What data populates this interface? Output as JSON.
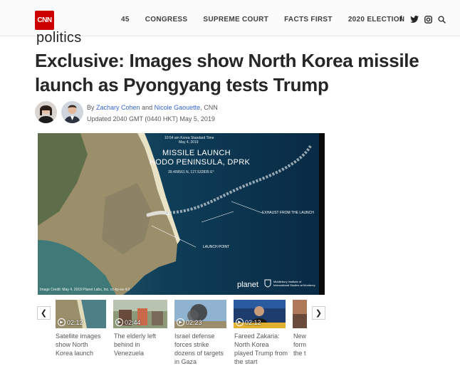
{
  "header": {
    "logo_text": "CNN",
    "nav": [
      "45",
      "CONGRESS",
      "SUPREME COURT",
      "FACTS FIRST",
      "2020 ELECTION"
    ],
    "social_icons": [
      "facebook-icon",
      "twitter-icon",
      "instagram-icon",
      "search-icon"
    ]
  },
  "section": "politics",
  "article": {
    "headline": "Exclusive: Images show North Korea missile launch as Pyongyang tests Trump",
    "by": "By",
    "author1": "Zachary Cohen",
    "and": "and",
    "author2": "Nicole Gaouette",
    "outlet": ", CNN",
    "updated": "Updated 2040 GMT (0440 HKT) May 5, 2019"
  },
  "hero": {
    "time": "10:54 am Korea Standard Time",
    "date": "May 4, 2019",
    "title1": "MISSILE LAUNCH",
    "title2": "HODO PENINSULA, DPRK",
    "coords": "39.409561 N, 127.532835 E°",
    "exhaust_label": "EXHAUST FROM THE LAUNCH",
    "launch_label": "LAUNCH POINT",
    "credit": "Image Credit: May 4, 2019 Planet Labs, Inc. cc-by-sa 4.0",
    "planet": "planet",
    "middlebury1": "Middlebury Institute of",
    "middlebury2": "International Studies at Monterey"
  },
  "videos": [
    {
      "duration": "02:12",
      "caption": "Satellite images show North Korea launch"
    },
    {
      "duration": "02:44",
      "caption": "The elderly left behind in Venezuela"
    },
    {
      "duration": "02:23",
      "caption": "Israel defense forces strike dozens of targets in Gaza"
    },
    {
      "duration": "02:12",
      "caption": "Fareed Zakaria: North Korea played Trump from the start"
    },
    {
      "duration": "",
      "caption": "New form the t"
    }
  ],
  "colors": {
    "brand": "#cc0000",
    "link": "#3366cc"
  }
}
